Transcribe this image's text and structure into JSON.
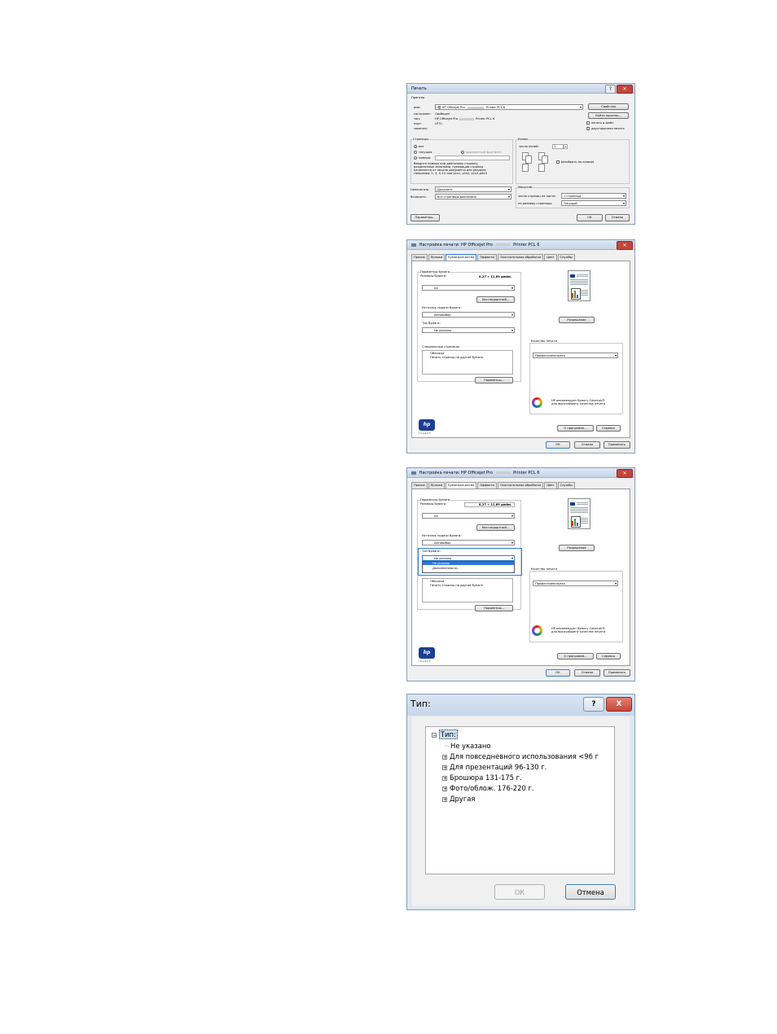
{
  "print_dialog": {
    "title": "Печать",
    "printer_group": "Принтер",
    "name_label": "имя:",
    "name_value": "HP Officejet Pro",
    "name_suffix": "Printer PCL 6",
    "status_label": "состояние:",
    "status_value": "Свободен",
    "type_label": "тип:",
    "type_value": "HP Officejet Pro",
    "type_suffix": "Printer PCL 6",
    "port_label": "порт:",
    "port_value": "LPT1:",
    "comment_label": "заметки:",
    "properties_button": "Свойства",
    "find_printer_button": "Найти принтер...",
    "print_to_file": "печать в файл",
    "manual_duplex": "двусторонняя печать",
    "pages_group": "Страницы",
    "all": "все",
    "current": "текущая",
    "selection": "выделенный фрагмент",
    "pages": "номера:",
    "hint_lines": [
      "Введите номера или диапазоны страниц,",
      "разделенные запятыми, нумерация страниц",
      "начинается от начала документа или раздела.",
      "Например: 1, 3, 5–12 или p1s1, p1s2, p1s3–p8s3"
    ],
    "copies_group": "Копии",
    "copies_label": "число копий:",
    "copies_value": "1",
    "collate": "разобрать по копиям",
    "print_what_label": "Напечатать:",
    "print_what_value": "Документ",
    "include_label": "Включить:",
    "include_value": "Все страницы диапазона",
    "zoom_group": "Масштаб",
    "pages_per_sheet_label": "число страниц на листе:",
    "pages_per_sheet_value": "1 страница",
    "scale_label": "по размеру страницы:",
    "scale_value": "Текущий",
    "options_button": "Параметры...",
    "ok_button": "ОК",
    "cancel_button": "Отмена"
  },
  "props_dialog": {
    "title": "Настройка печати: HP Officejet Pro",
    "title_suffix": "Printer PCL 6",
    "tabs": [
      "Прочие",
      "Ярлыки",
      "Бумага/качество",
      "Эффекты",
      "Окончательная обработка",
      "Цвет",
      "Службы"
    ],
    "paper_options": "Параметры бумаги",
    "paper_size_label": "Размеры бумаги:",
    "paper_size_dims": "8,27 × 11,69 дюйм.",
    "paper_size_value": "A4",
    "custom_button": "Нестандартный...",
    "source_label": "Источник подачи бумаги:",
    "source_value": "Автовыбор",
    "type_label": "Тип бумаги:",
    "type_value": "Не указано",
    "special_pages_label": "Специальные страницы:",
    "special_items": [
      "Обложки",
      "Печать страниц на другой бумаге"
    ],
    "settings_button": "Параметры...",
    "resolution_button": "Разрешение",
    "quality_label": "Качество печати",
    "quality_value": "Профессиональная",
    "colorlok_text": [
      "HP рекомендует бумагу ColorLok®",
      "для высочайшего качества печати"
    ],
    "hp_logo": "hp",
    "hp_invent": "invent",
    "about_button": "О программе...",
    "help_button": "Справка",
    "ok_button": "ОК",
    "cancel_button": "Отмена",
    "apply_button": "Применить",
    "dropdown_options": [
      "Не указано",
      "Дополнительно..."
    ]
  },
  "type_dialog": {
    "title": "Тип:",
    "help_icon": "?",
    "close_icon": "X",
    "root": "Тип:",
    "items": [
      "Не указано",
      "Для повседневного использования <96 г",
      "Для презентаций 96-130 г.",
      "Брошюра 131-175 г.",
      "Фото/облож. 176-220 г.",
      "Другая"
    ],
    "ok_button": "ОК",
    "cancel_button": "Отмена"
  }
}
